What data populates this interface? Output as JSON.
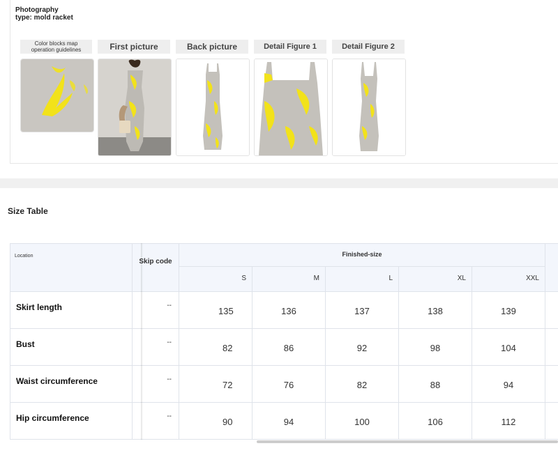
{
  "photography": {
    "title_line1": "Photography",
    "title_line2": "type: mold racket",
    "columns": [
      {
        "label": "Color blocks map operation guidelines",
        "label_line1": "Color blocks map",
        "label_line2": "operation guidelines"
      },
      {
        "label": "First picture"
      },
      {
        "label": "Back picture"
      },
      {
        "label": "Detail Figure 1"
      },
      {
        "label": "Detail Figure 2"
      }
    ]
  },
  "size_table": {
    "title": "Size Table",
    "location_header": "Location",
    "skip_code_header": "Skip code",
    "finished_size_header": "Finished-size",
    "sizes": [
      "S",
      "M",
      "L",
      "XL",
      "XXL"
    ],
    "rows": [
      {
        "label": "Skirt length",
        "skip": "--",
        "values": [
          "135",
          "136",
          "137",
          "138",
          "139"
        ]
      },
      {
        "label": "Bust",
        "skip": "--",
        "values": [
          "82",
          "86",
          "92",
          "98",
          "104"
        ]
      },
      {
        "label": "Waist circumference",
        "skip": "--",
        "values": [
          "72",
          "76",
          "82",
          "88",
          "94"
        ]
      },
      {
        "label": "Hip circumference",
        "skip": "--",
        "values": [
          "90",
          "94",
          "100",
          "106",
          "112"
        ]
      }
    ]
  },
  "colors": {
    "dress_base": "#bdbab4",
    "dress_print": "#f2e21a",
    "header_bg": "#f3f6fc"
  }
}
